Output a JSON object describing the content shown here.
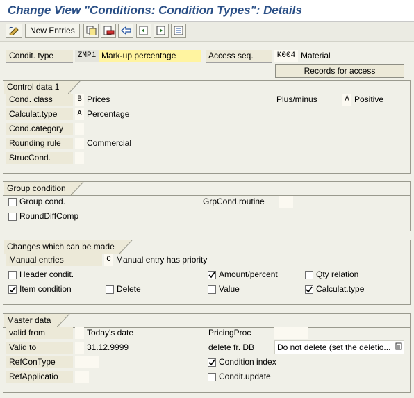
{
  "window": {
    "title": "Change View \"Conditions: Condition Types\": Details"
  },
  "toolbar": {
    "new_entries": "New Entries",
    "icons": [
      "edit-toggle-icon",
      "copy-icon",
      "delete-icon",
      "undo-icon",
      "previous-entry-icon",
      "next-entry-icon",
      "select-all-icon"
    ]
  },
  "header": {
    "cond_type_label": "Condit. type",
    "cond_type_value": "ZMP1",
    "cond_type_desc": "Mark-up percentage",
    "access_seq_label": "Access seq.",
    "access_seq_value": "K004",
    "access_seq_desc": "Material",
    "records_button": "Records for access"
  },
  "control": {
    "title": "Control data 1",
    "cond_class_label": "Cond. class",
    "cond_class_value": "B",
    "cond_class_text": "Prices",
    "plus_minus_label": "Plus/minus",
    "plus_minus_value": "A",
    "plus_minus_text": "Positive",
    "calc_type_label": "Calculat.type",
    "calc_type_value": "A",
    "calc_type_text": "Percentage",
    "cond_category_label": "Cond.category",
    "cond_category_value": "",
    "rounding_label": "Rounding rule",
    "rounding_value": "",
    "rounding_text": "Commercial",
    "struc_label": "StrucCond.",
    "struc_value": ""
  },
  "group": {
    "title": "Group condition",
    "group_cond": "Group cond.",
    "group_cond_checked": false,
    "round_diff": "RoundDiffComp",
    "round_diff_checked": false,
    "grp_routine_label": "GrpCond.routine",
    "grp_routine_value": ""
  },
  "changes": {
    "title": "Changes which can be made",
    "manual_label": "Manual entries",
    "manual_value": "C",
    "manual_text": "Manual entry has priority",
    "header_condit": "Header condit.",
    "header_condit_checked": false,
    "amount_percent": "Amount/percent",
    "amount_percent_checked": true,
    "qty_relation": "Qty relation",
    "qty_relation_checked": false,
    "item_condition": "Item condition",
    "item_condition_checked": true,
    "delete": "Delete",
    "delete_checked": false,
    "value": "Value",
    "value_checked": false,
    "calc_type": "Calculat.type",
    "calc_type_checked": true
  },
  "master": {
    "title": "Master data",
    "valid_from_label": "valid from",
    "valid_from_text": "Today's date",
    "valid_to_label": "Valid to",
    "valid_to_text": "31.12.9999",
    "ref_con_type_label": "RefConType",
    "ref_appl_label": "RefApplicatio",
    "pricing_proc_label": "PricingProc",
    "pricing_proc_value": "",
    "delete_db_label": "delete fr. DB",
    "delete_db_value": "Do not delete (set the deletio...",
    "condition_index": "Condition index",
    "condition_index_checked": true,
    "condit_update": "Condit.update",
    "condit_update_checked": false
  },
  "colors": {
    "title": "#2a4f86",
    "highlight_field": "#fff4a0",
    "background": "#f0f0e8"
  }
}
